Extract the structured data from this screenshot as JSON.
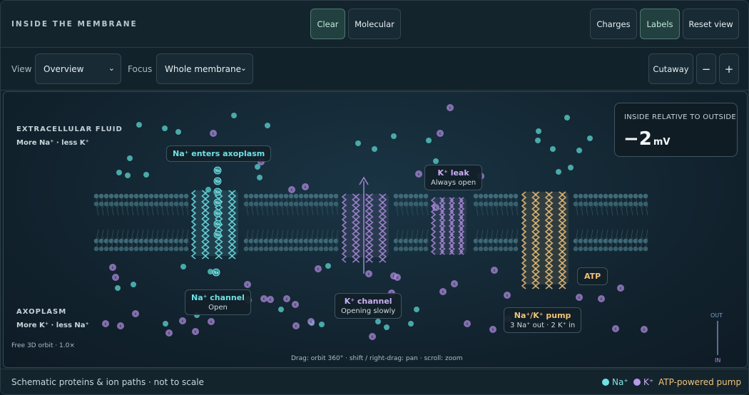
{
  "header": {
    "title": "INSIDE THE MEMBRANE",
    "buttons": {
      "clear": "Clear",
      "molecular": "Molecular",
      "charges": "Charges",
      "labels": "Labels",
      "reset": "Reset view"
    }
  },
  "toolbar": {
    "view_label": "View",
    "view_value": "Overview",
    "focus_label": "Focus",
    "focus_value": "Whole membrane",
    "cutaway": "Cutaway",
    "zoom_out": "−",
    "zoom_in": "+"
  },
  "scene": {
    "extracellular": {
      "title": "EXTRACELLULAR FLUID",
      "sub": "More Na⁺ · less K⁺"
    },
    "axoplasm": {
      "title": "AXOPLASM",
      "sub": "More K⁺ · less Na⁺"
    },
    "callouts": {
      "na_enters": "Na⁺ enters axoplasm",
      "na_channel": {
        "title": "Na⁺ channel",
        "sub": "Open"
      },
      "k_leak": {
        "title": "K⁺ leak",
        "sub": "Always open"
      },
      "k_channel": {
        "title": "K⁺ channel",
        "sub": "Opening slowly"
      },
      "pump": {
        "title": "Na⁺/K⁺ pump",
        "sub": "3 Na⁺ out · 2 K⁺ in"
      },
      "atp": "ATP"
    },
    "ion_na": "Na",
    "ion_k": "K",
    "potential": {
      "label": "INSIDE RELATIVE TO OUTSIDE",
      "value": "−2",
      "unit": "mV"
    },
    "orbit": "Free 3D orbit · 1.0×",
    "controls_hint": "Drag: orbit 360° · shift / right-drag: pan · scroll: zoom",
    "scale": {
      "out": "OUT",
      "in": "IN"
    }
  },
  "footer": {
    "note": "Schematic proteins & ion paths · not to scale",
    "legend_na": "Na⁺",
    "legend_k": "K⁺",
    "legend_pump": "ATP-powered pump"
  },
  "colors": {
    "na": "#4fb8b6",
    "na_channel": "#6fe0e6",
    "k": "#a98bd8",
    "pump": "#f0c27a",
    "lipid": "#3f6a78"
  }
}
